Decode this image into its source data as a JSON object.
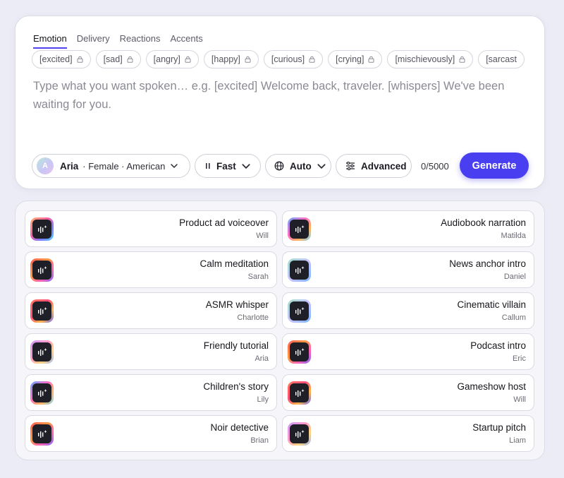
{
  "tabs": [
    {
      "label": "Emotion",
      "active": true
    },
    {
      "label": "Delivery",
      "active": false
    },
    {
      "label": "Reactions",
      "active": false
    },
    {
      "label": "Accents",
      "active": false
    }
  ],
  "tags": [
    "[excited]",
    "[sad]",
    "[angry]",
    "[happy]",
    "[curious]",
    "[crying]",
    "[mischievously]",
    "[sarcast"
  ],
  "prompt": {
    "placeholder": "Type what you want spoken… e.g. [excited] Welcome back, traveler. [whispers] We've been waiting for you."
  },
  "voice": {
    "avatar_letter": "A",
    "name": "Aria",
    "meta": "· Female · American"
  },
  "speed": {
    "label": "Fast",
    "icon": "pause-icon"
  },
  "language": {
    "label": "Auto",
    "icon": "globe-icon"
  },
  "advanced": {
    "label": "Advanced",
    "icon": "sliders-icon"
  },
  "counter": "0/5000",
  "generate_label": "Generate",
  "colors": {
    "accent": "#4a3ff0",
    "tab_underline": "#4f43ef"
  },
  "presets": [
    {
      "title": "Product ad voiceover",
      "voice": "Will",
      "icon": "waveform-sparkle-icon"
    },
    {
      "title": "Audiobook narration",
      "voice": "Matilda",
      "icon": "waveform-sparkle-icon"
    },
    {
      "title": "Calm meditation",
      "voice": "Sarah",
      "icon": "waveform-sparkle-icon"
    },
    {
      "title": "News anchor intro",
      "voice": "Daniel",
      "icon": "waveform-sparkle-icon"
    },
    {
      "title": "ASMR whisper",
      "voice": "Charlotte",
      "icon": "waveform-sparkle-icon"
    },
    {
      "title": "Cinematic villain",
      "voice": "Callum",
      "icon": "waveform-sparkle-icon"
    },
    {
      "title": "Friendly tutorial",
      "voice": "Aria",
      "icon": "waveform-sparkle-icon"
    },
    {
      "title": "Podcast intro",
      "voice": "Eric",
      "icon": "waveform-sparkle-icon"
    },
    {
      "title": "Children's story",
      "voice": "Lily",
      "icon": "waveform-sparkle-icon"
    },
    {
      "title": "Gameshow host",
      "voice": "Will",
      "icon": "waveform-sparkle-icon"
    },
    {
      "title": "Noir detective",
      "voice": "Brian",
      "icon": "waveform-sparkle-icon"
    },
    {
      "title": "Startup pitch",
      "voice": "Liam",
      "icon": "waveform-sparkle-icon"
    }
  ]
}
